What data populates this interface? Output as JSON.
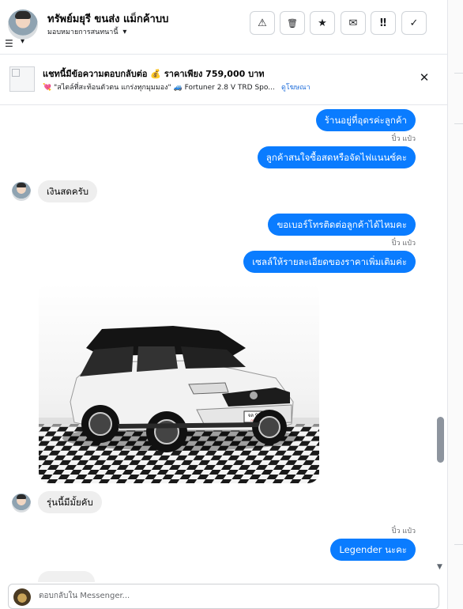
{
  "header": {
    "contact_name": "ทรัพย์มยุรี ขนส่ง แม็กค้าบบ",
    "assign_label": "มอบหมายการสนทนานี้",
    "actions": [
      {
        "icon": "warning-icon",
        "glyph": "⚠"
      },
      {
        "icon": "trash-icon",
        "glyph": "🗑"
      },
      {
        "icon": "star-icon",
        "glyph": "★"
      },
      {
        "icon": "envelope-icon",
        "glyph": "✉"
      },
      {
        "icon": "priority-icon",
        "glyph": "‼"
      },
      {
        "icon": "check-icon",
        "glyph": "✓"
      }
    ]
  },
  "ad_banner": {
    "title": "แชทนี้มีข้อความตอบกลับต่อ 💰 ราคาเพียง 759,000 บาท",
    "description": "💘 \"สไตล์ที่สะท้อนตัวตน แกร่งทุกมุมมอง\" 🚙 Fortuner 2.8 V TRD Spo...",
    "link": "ดูโฆษณา",
    "close_glyph": "✕"
  },
  "messages": [
    {
      "side": "out",
      "text": "ร้านอยู่ที่อุดรค่ะลูกค้า"
    },
    {
      "side": "label",
      "text": "ปิ๋ว แป๋ว"
    },
    {
      "side": "out",
      "text": "ลูกค้าสนใจซื้อสดหรือจัดไฟแนนซ์คะ"
    },
    {
      "side": "in",
      "text": "เงินสดครับ"
    },
    {
      "side": "out",
      "text": "ขอเบอร์โทรติดต่อลูกค้าได้ไหมคะ"
    },
    {
      "side": "label",
      "text": "ปิ๋ว แป๋ว"
    },
    {
      "side": "out",
      "text": "เซลล์ให้รายละเอียดของราคาเพิ่มเติมค่ะ"
    },
    {
      "side": "in",
      "text": "รุ่นนี้มีมั้ยคับ"
    },
    {
      "side": "label",
      "text": "ปิ๋ว แป๋ว"
    },
    {
      "side": "out",
      "text": "Legender นะคะ"
    }
  ],
  "photo": {
    "plate_line1": "จล 946",
    "plate_line2": "กรุงเทพ"
  },
  "composer": {
    "placeholder": "ตอบกลับใน Messenger..."
  },
  "icons": {
    "filter": "☰",
    "caret": "▾",
    "scroll_down": "▼"
  }
}
